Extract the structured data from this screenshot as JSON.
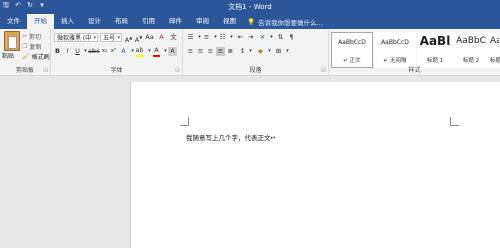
{
  "window": {
    "title": "文档1 - Word"
  },
  "tabs": [
    "文件",
    "开始",
    "插入",
    "设计",
    "布局",
    "引用",
    "邮件",
    "审阅",
    "视图"
  ],
  "active_tab": "开始",
  "tell_me": "告诉我你想要做什么...",
  "clipboard": {
    "paste": "粘贴",
    "cut": "剪切",
    "copy": "复制",
    "format_painter": "格式刷",
    "group_label": "剪贴板"
  },
  "font": {
    "name": "微软雅黑 (中",
    "size": "五号",
    "group_label": "字体",
    "highlight_color": "#ffff00",
    "font_color": "#ff0000"
  },
  "paragraph": {
    "group_label": "段落"
  },
  "styles": {
    "group_label": "样式",
    "items": [
      {
        "preview": "AaBbCcD",
        "name": "↵ 正文"
      },
      {
        "preview": "AaBbCcD",
        "name": "↵ 无间隔"
      },
      {
        "preview": "AaBl",
        "name": "标题 1"
      },
      {
        "preview": "AaBbC",
        "name": "标题 2"
      },
      {
        "preview": "AaBbC",
        "name": "标题"
      }
    ]
  },
  "document": {
    "text": "我随意写上几个字，代表正文↵"
  }
}
